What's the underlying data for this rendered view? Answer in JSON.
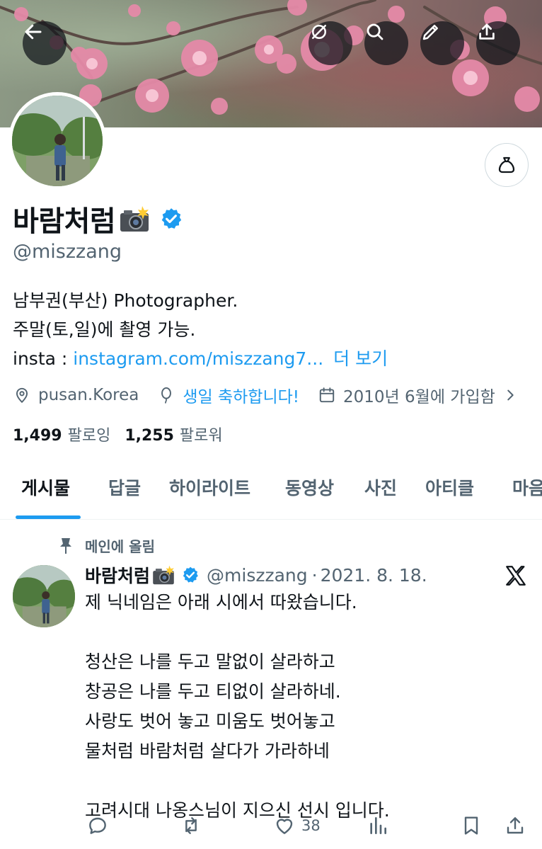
{
  "header": {
    "back_icon": "arrow-left-icon",
    "hide_icon": "eye-slash-icon",
    "search_icon": "search-icon",
    "edit_icon": "pencil-icon",
    "share_icon": "share-icon",
    "bag_icon": "money-bag-icon"
  },
  "profile": {
    "display_name": "바람처럼",
    "camera_emoji": "camera-with-flash-icon",
    "verified": true,
    "handle": "@miszzang",
    "bio": {
      "line1": "남부권(부산) Photographer.",
      "line2": "주말(토,일)에 촬영 가능.",
      "line3_prefix": "insta : ",
      "line3_link": "instagram.com/miszzang7...",
      "more": "더 보기"
    },
    "location": "pusan.Korea",
    "birthday": "생일 축하합니다!",
    "joined": "2010년 6월에 가입함",
    "following_count": "1,499",
    "following_label": "팔로잉",
    "followers_count": "1,255",
    "followers_label": "팔로워"
  },
  "tabs": [
    {
      "label": "게시물",
      "active": true
    },
    {
      "label": "답글",
      "active": false
    },
    {
      "label": "하이라이트",
      "active": false
    },
    {
      "label": "동영상",
      "active": false
    },
    {
      "label": "사진",
      "active": false
    },
    {
      "label": "아티클",
      "active": false
    },
    {
      "label": "마음",
      "active": false
    }
  ],
  "tweet": {
    "pinned_label": "메인에 올림",
    "name": "바람처럼",
    "handle": "@miszzang",
    "separator": "·",
    "date": "2021. 8. 18.",
    "body": "제 닉네임은 아래 시에서 따왔습니다.\n\n청산은 나를 두고 말없이 살라하고\n창공은 나를 두고 티없이 살라하네.\n사랑도 벗어 놓고 미움도 벗어놓고\n물처럼 바람처럼 살다가 가라하네\n\n고려시대 나옹스님이 지으신 선시 입니다.",
    "likes": "38"
  },
  "colors": {
    "accent": "#1d9bf0",
    "text": "#0f1419",
    "muted": "#536471",
    "border": "#eff3f4"
  }
}
